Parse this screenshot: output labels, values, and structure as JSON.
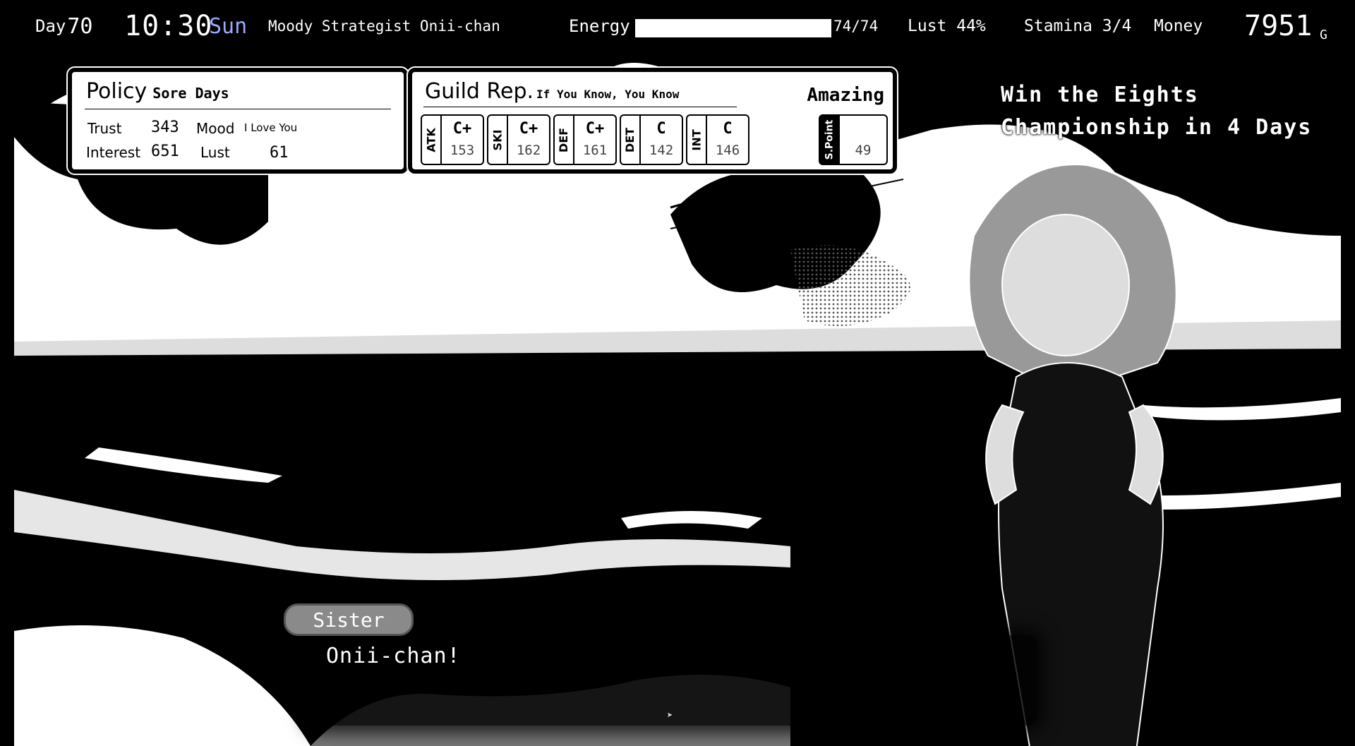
{
  "status": {
    "day_label": "Day",
    "day_value": "70",
    "time": "10:30",
    "weekday": "Sun",
    "title": "Moody Strategist Onii-chan",
    "energy_label": "Energy",
    "energy_value": "74/74",
    "energy_fraction": 1.0,
    "lust": "Lust  44%",
    "stamina": "Stamina 3/4",
    "money_label": "Money",
    "money_value": "7951",
    "money_unit": "G"
  },
  "policy": {
    "title": "Policy",
    "subtitle": "Sore Days",
    "trust_label": "Trust",
    "trust_value": "343",
    "mood_label": "Mood",
    "mood_value": "I Love You",
    "interest_label": "Interest",
    "interest_value": "651",
    "lust_label": "Lust",
    "lust_value": "61"
  },
  "guild": {
    "title": "Guild Rep.",
    "subtitle": "If You Know, You Know",
    "rank": "Amazing",
    "stats": [
      {
        "label": "ATK",
        "grade": "C+",
        "value": "153"
      },
      {
        "label": "SKI",
        "grade": "C+",
        "value": "162"
      },
      {
        "label": "DEF",
        "grade": "C+",
        "value": "161"
      },
      {
        "label": "DET",
        "grade": "C",
        "value": "142"
      },
      {
        "label": "INT",
        "grade": "C",
        "value": "146"
      }
    ],
    "spoint_label": "S.Point",
    "spoint_value": "49"
  },
  "mission": {
    "line1": "Win the Eights",
    "line2": "Championship in 4 Days"
  },
  "dialogue": {
    "speaker": "Sister",
    "text": "Onii-chan!"
  },
  "colors": {
    "weekday": "#9aa8ff",
    "background": "#000000",
    "panel": "#ffffff"
  }
}
